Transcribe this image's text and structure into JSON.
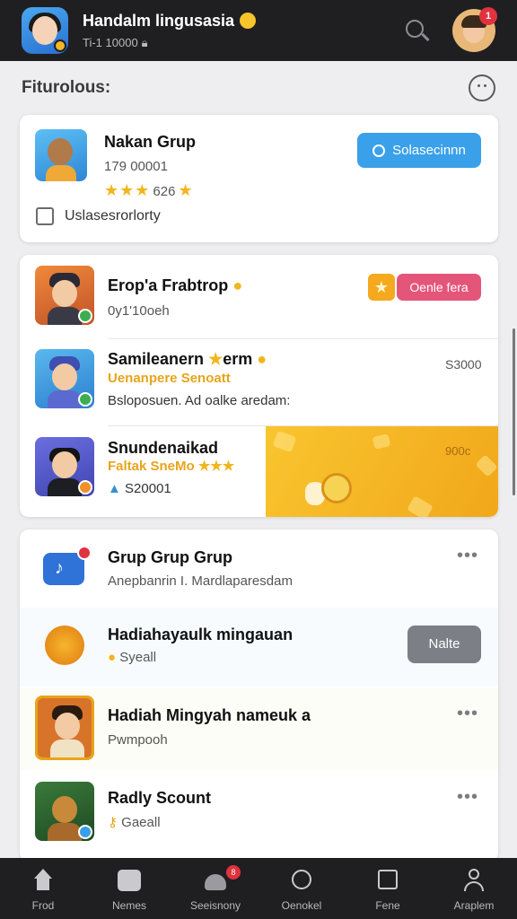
{
  "header": {
    "title": "Handalm lingusasia",
    "subtitle": "Ti-1 10000",
    "notification_count": "1"
  },
  "section": {
    "title": "Fiturolous:"
  },
  "featured": {
    "title": "Nakan Grup",
    "meta": "179 00001",
    "rating": "626",
    "button_label": "Solasecinnn",
    "checkbox_label": "Uslasesrorlorty"
  },
  "list": {
    "items": [
      {
        "title": "Erop'a Frabtrop",
        "sub": "0y1'10oeh",
        "button_label": "Oenle fera"
      },
      {
        "title": "Samileanern",
        "tag": "erm",
        "accent": "Uenanpere Senoatt",
        "sub": "Bsloposuen. Ad oalke aredam:",
        "price": "S3000"
      },
      {
        "title": "Snundenaikad",
        "accent": "Faltak SneMo",
        "sub": "S20001",
        "promo_price": "900c"
      }
    ]
  },
  "groups": {
    "items": [
      {
        "title": "Grup Grup Grup",
        "sub": "Anepbanrin I. Mardlaparesdam"
      },
      {
        "title": "Hadiahayaulk mingauan",
        "sub": "Syeall",
        "button_label": "Nalte"
      },
      {
        "title": "Hadiah Mingyah nameuk a",
        "sub": "Pwmpooh"
      },
      {
        "title": "Radly Scount",
        "sub": "Gaeall"
      }
    ]
  },
  "nav": {
    "items": [
      {
        "label": "Frod"
      },
      {
        "label": "Nemes"
      },
      {
        "label": "Seeisnony",
        "badge": "8"
      },
      {
        "label": "Oenokel"
      },
      {
        "label": "Fene"
      },
      {
        "label": "Araplem"
      }
    ]
  },
  "colors": {
    "bar": "#1f1f22",
    "accent_blue": "#3aa0ea",
    "accent_pink": "#e4557a",
    "accent_yellow": "#f2b51c"
  }
}
